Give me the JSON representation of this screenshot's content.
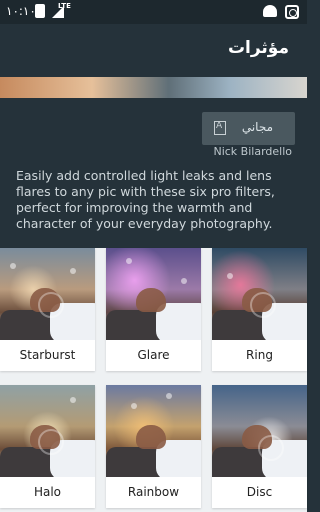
{
  "status_bar": {
    "time": "١٠:١٠",
    "network": "LTE"
  },
  "app_bar": {
    "title": "مؤثرات"
  },
  "pack": {
    "free_label": "مجاني",
    "author": "Nick Bilardello",
    "description": "Easily add controlled light leaks and lens flares to any pic with these six pro filters, perfect for improving the warmth and character of your everyday photography."
  },
  "filters": [
    {
      "name": "Starburst"
    },
    {
      "name": "Glare"
    },
    {
      "name": "Ring"
    },
    {
      "name": "Halo"
    },
    {
      "name": "Rainbow"
    },
    {
      "name": "Disc"
    }
  ]
}
